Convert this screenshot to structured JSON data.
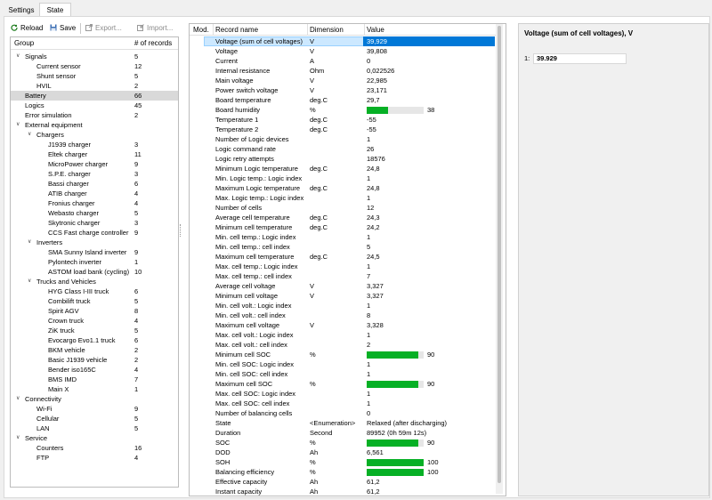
{
  "tabs": [
    "Settings",
    "State"
  ],
  "toolbar": {
    "reload": "Reload",
    "save": "Save",
    "export": "Export...",
    "import": "Import..."
  },
  "tree": {
    "col_group": "Group",
    "col_count": "# of records",
    "rows": [
      {
        "label": "Signals",
        "count": "5",
        "level": 0,
        "arrow": "v"
      },
      {
        "label": "Current sensor",
        "count": "12",
        "level": 1
      },
      {
        "label": "Shunt sensor",
        "count": "5",
        "level": 1
      },
      {
        "label": "HVIL",
        "count": "2",
        "level": 1
      },
      {
        "label": "Battery",
        "count": "66",
        "level": 0,
        "sel": true
      },
      {
        "label": "Logics",
        "count": "45",
        "level": 0
      },
      {
        "label": "Error simulation",
        "count": "2",
        "level": 0
      },
      {
        "label": "External equipment",
        "count": "",
        "level": 0,
        "arrow": "v"
      },
      {
        "label": "Chargers",
        "count": "",
        "level": 1,
        "arrow": "v"
      },
      {
        "label": "J1939 charger",
        "count": "3",
        "level": 2
      },
      {
        "label": "Eltek charger",
        "count": "11",
        "level": 2
      },
      {
        "label": "MicroPower charger",
        "count": "9",
        "level": 2
      },
      {
        "label": "S.P.E. charger",
        "count": "3",
        "level": 2
      },
      {
        "label": "Bassi charger",
        "count": "6",
        "level": 2
      },
      {
        "label": "ATIB charger",
        "count": "4",
        "level": 2
      },
      {
        "label": "Fronius charger",
        "count": "4",
        "level": 2
      },
      {
        "label": "Webasto charger",
        "count": "5",
        "level": 2
      },
      {
        "label": "Skytronic charger",
        "count": "3",
        "level": 2
      },
      {
        "label": "CCS Fast charge controller",
        "count": "9",
        "level": 2
      },
      {
        "label": "Inverters",
        "count": "",
        "level": 1,
        "arrow": "v"
      },
      {
        "label": "SMA Sunny Island inverter",
        "count": "9",
        "level": 2
      },
      {
        "label": "Pylontech inverter",
        "count": "1",
        "level": 2
      },
      {
        "label": "ASTOM load bank (cycling)",
        "count": "10",
        "level": 2
      },
      {
        "label": "Trucks and Vehicles",
        "count": "",
        "level": 1,
        "arrow": "v"
      },
      {
        "label": "HYG Class I-III truck",
        "count": "6",
        "level": 2
      },
      {
        "label": "Combilift truck",
        "count": "5",
        "level": 2
      },
      {
        "label": "Spirit AGV",
        "count": "8",
        "level": 2
      },
      {
        "label": "Crown truck",
        "count": "4",
        "level": 2
      },
      {
        "label": "ZiK truck",
        "count": "5",
        "level": 2
      },
      {
        "label": "Evocargo Evo1.1 truck",
        "count": "6",
        "level": 2
      },
      {
        "label": "BKM vehicle",
        "count": "2",
        "level": 2
      },
      {
        "label": "Basic J1939 vehicle",
        "count": "2",
        "level": 2
      },
      {
        "label": "Bender iso165C",
        "count": "4",
        "level": 2
      },
      {
        "label": "BMS IMD",
        "count": "7",
        "level": 2
      },
      {
        "label": "Main X",
        "count": "1",
        "level": 2
      },
      {
        "label": "Connectivity",
        "count": "",
        "level": 0,
        "arrow": "v"
      },
      {
        "label": "Wi-Fi",
        "count": "9",
        "level": 1
      },
      {
        "label": "Cellular",
        "count": "5",
        "level": 1
      },
      {
        "label": "LAN",
        "count": "5",
        "level": 1
      },
      {
        "label": "Service",
        "count": "",
        "level": 0,
        "arrow": "v"
      },
      {
        "label": "Counters",
        "count": "16",
        "level": 1
      },
      {
        "label": "FTP",
        "count": "4",
        "level": 1
      }
    ]
  },
  "records": {
    "col_mod": "Mod.",
    "col_name": "Record name",
    "col_dim": "Dimension",
    "col_value": "Value",
    "rows": [
      {
        "name": "Voltage (sum of cell voltages)",
        "dim": "V",
        "value": "39,929",
        "sel": true
      },
      {
        "name": "Voltage",
        "dim": "V",
        "value": "39,808"
      },
      {
        "name": "Current",
        "dim": "A",
        "value": "0"
      },
      {
        "name": "Internal resistance",
        "dim": "Ohm",
        "value": "0,022526"
      },
      {
        "name": "Main voltage",
        "dim": "V",
        "value": "22,985"
      },
      {
        "name": "Power switch voltage",
        "dim": "V",
        "value": "23,171"
      },
      {
        "name": "Board temperature",
        "dim": "deg.C",
        "value": "29,7"
      },
      {
        "name": "Board humidity",
        "dim": "%",
        "value": "38",
        "bar": 0.38
      },
      {
        "name": "Temperature 1",
        "dim": "deg.C",
        "value": "-55"
      },
      {
        "name": "Temperature 2",
        "dim": "deg.C",
        "value": "-55"
      },
      {
        "name": "Number of Logic devices",
        "dim": "",
        "value": "1"
      },
      {
        "name": "Logic command rate",
        "dim": "",
        "value": "26"
      },
      {
        "name": "Logic retry attempts",
        "dim": "",
        "value": "18576"
      },
      {
        "name": "Minimum Logic temperature",
        "dim": "deg.C",
        "value": "24,8"
      },
      {
        "name": "Min. Logic temp.: Logic index",
        "dim": "",
        "value": "1"
      },
      {
        "name": "Maximum Logic temperature",
        "dim": "deg.C",
        "value": "24,8"
      },
      {
        "name": "Max. Logic temp.: Logic index",
        "dim": "",
        "value": "1"
      },
      {
        "name": "Number of cells",
        "dim": "",
        "value": "12"
      },
      {
        "name": "Average cell temperature",
        "dim": "deg.C",
        "value": "24,3"
      },
      {
        "name": "Minimum cell temperature",
        "dim": "deg.C",
        "value": "24,2"
      },
      {
        "name": "Min. cell temp.: Logic index",
        "dim": "",
        "value": "1"
      },
      {
        "name": "Min. cell temp.: cell index",
        "dim": "",
        "value": "5"
      },
      {
        "name": "Maximum cell temperature",
        "dim": "deg.C",
        "value": "24,5"
      },
      {
        "name": "Max. cell temp.: Logic index",
        "dim": "",
        "value": "1"
      },
      {
        "name": "Max. cell temp.: cell index",
        "dim": "",
        "value": "7"
      },
      {
        "name": "Average cell voltage",
        "dim": "V",
        "value": "3,327"
      },
      {
        "name": "Minimum cell voltage",
        "dim": "V",
        "value": "3,327"
      },
      {
        "name": "Min. cell volt.: Logic index",
        "dim": "",
        "value": "1"
      },
      {
        "name": "Min. cell volt.: cell index",
        "dim": "",
        "value": "8"
      },
      {
        "name": "Maximum cell voltage",
        "dim": "V",
        "value": "3,328"
      },
      {
        "name": "Max. cell volt.: Logic index",
        "dim": "",
        "value": "1"
      },
      {
        "name": "Max. cell volt.: cell index",
        "dim": "",
        "value": "2"
      },
      {
        "name": "Minimum cell SOC",
        "dim": "%",
        "value": "90",
        "bar": 0.9
      },
      {
        "name": "Min. cell SOC: Logic index",
        "dim": "",
        "value": "1"
      },
      {
        "name": "Min. cell SOC: cell index",
        "dim": "",
        "value": "1"
      },
      {
        "name": "Maximum cell SOC",
        "dim": "%",
        "value": "90",
        "bar": 0.9
      },
      {
        "name": "Max. cell SOC: Logic index",
        "dim": "",
        "value": "1"
      },
      {
        "name": "Max. cell SOC: cell index",
        "dim": "",
        "value": "1"
      },
      {
        "name": "Number of balancing cells",
        "dim": "",
        "value": "0"
      },
      {
        "name": "State",
        "dim": "<Enumeration>",
        "value": "Relaxed (after discharging)"
      },
      {
        "name": "Duration",
        "dim": "Second",
        "value": "89952 (0h 59m 12s)"
      },
      {
        "name": "SOC",
        "dim": "%",
        "value": "90",
        "bar": 0.9
      },
      {
        "name": "DOD",
        "dim": "Ah",
        "value": "6,561"
      },
      {
        "name": "SOH",
        "dim": "%",
        "value": "100",
        "bar": 1.0
      },
      {
        "name": "Balancing efficiency",
        "dim": "%",
        "value": "100",
        "bar": 1.0
      },
      {
        "name": "Effective capacity",
        "dim": "Ah",
        "value": "61,2"
      },
      {
        "name": "Instant capacity",
        "dim": "Ah",
        "value": "61,2"
      }
    ]
  },
  "detail": {
    "title": "Voltage (sum of cell voltages), V",
    "index": "1:",
    "value": "39.929"
  },
  "colors": {
    "accent": "#0078d7",
    "bar_fill": "#06b025",
    "selection_light": "#cce8ff"
  }
}
